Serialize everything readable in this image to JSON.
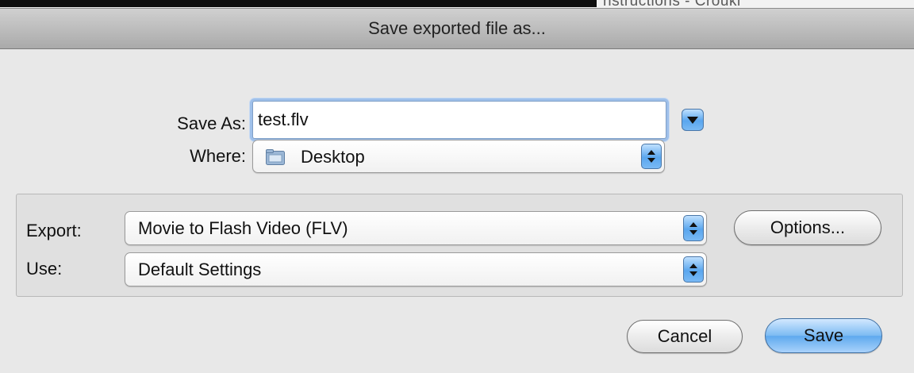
{
  "background": {
    "partial_text": "nstructions - Crouki"
  },
  "dialog": {
    "title": "Save exported file as..."
  },
  "save_as": {
    "label": "Save As:",
    "value": "test.flv",
    "expand_icon": "triangle-down-icon"
  },
  "where": {
    "label": "Where:",
    "selected": "Desktop",
    "icon": "folder-icon"
  },
  "export": {
    "label": "Export:",
    "selected": "Movie to Flash Video (FLV)",
    "options_label": "Options..."
  },
  "use": {
    "label": "Use:",
    "selected": "Default Settings"
  },
  "buttons": {
    "cancel": "Cancel",
    "save": "Save"
  },
  "colors": {
    "accent": "#5aa6ee",
    "dialog_bg": "#e8e8e8"
  }
}
